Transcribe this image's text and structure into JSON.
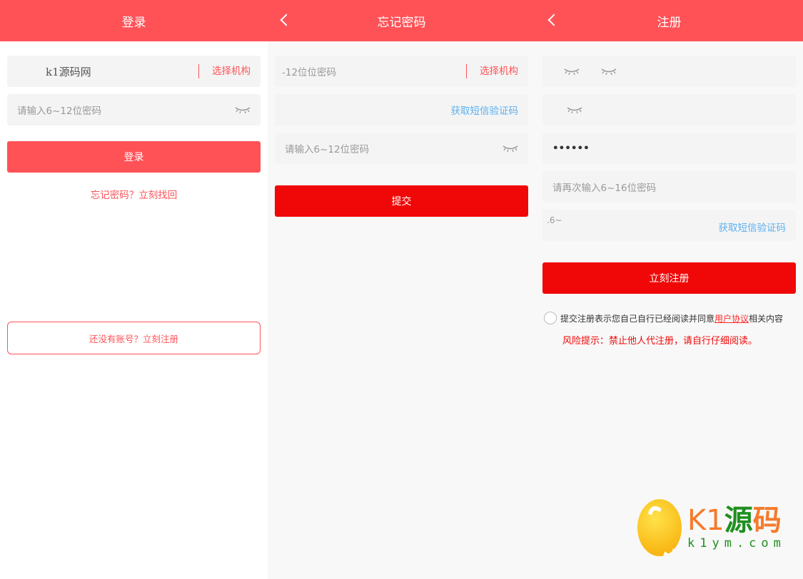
{
  "login": {
    "title": "登录",
    "account_value": "k1源码网",
    "org_label": "选择机构",
    "password_placeholder": "请输入6~12位密码",
    "login_button": "登录",
    "forgot_link": "忘记密码？立刻找回",
    "register_link": "还没有账号？立刻注册"
  },
  "forgot": {
    "title": "忘记密码",
    "field1_text": "-12位位密码",
    "org_label": "选择机构",
    "sms_label": "获取短信验证码",
    "password_placeholder": "请输入6~12位密码",
    "submit_button": "提交"
  },
  "register": {
    "title": "注册",
    "password_value": "••••••",
    "confirm_placeholder": "请再次输入6~16位密码",
    "code_text": ".6~",
    "sms_label": "获取短信验证码",
    "register_button": "立刻注册",
    "agree_prefix": "提交注册表示您自己自行已经阅读并同意",
    "agree_link": "用户协议",
    "agree_suffix": "相关内容",
    "risk_text": "风险提示：禁止他人代注册，请自行仔细阅读。"
  },
  "logo": {
    "brand_k1": "K1",
    "brand_yuan": "源",
    "brand_ma": "码",
    "domain": "k1ym.com"
  },
  "colors": {
    "header": "#ff5257",
    "submit": "#f00808",
    "sms": "#5bb0f0"
  }
}
